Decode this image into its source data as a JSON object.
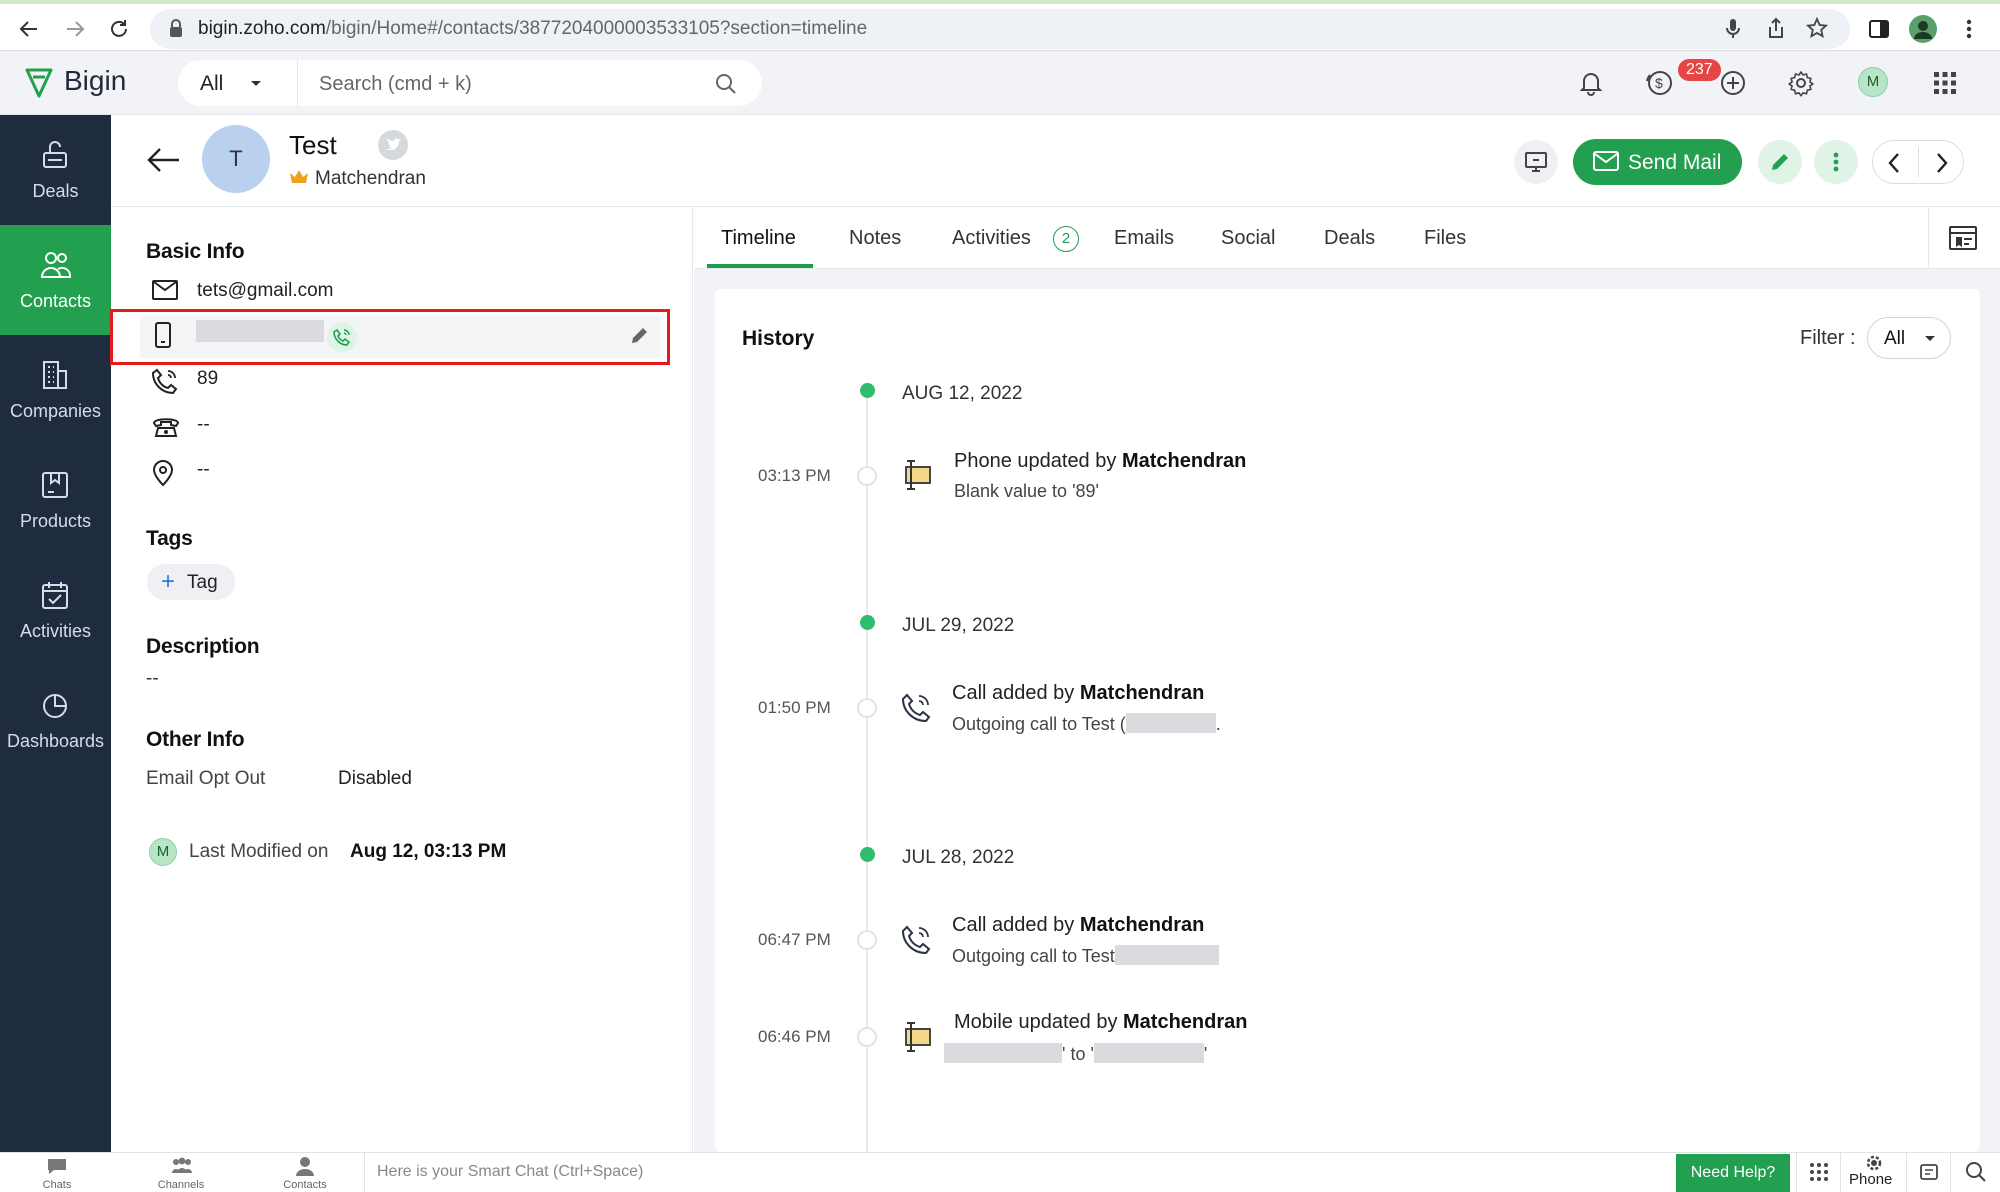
{
  "browser": {
    "url_host": "bigin.zoho.com",
    "url_path": "/bigin/Home#/contacts/3877204000003533105?section=timeline"
  },
  "header": {
    "app_name": "Bigin",
    "search_scope": "All",
    "search_placeholder": "Search (cmd + k)",
    "badge_count": "237",
    "user_initial": "M"
  },
  "sidebar": {
    "items": [
      {
        "label": "Deals",
        "icon": "deals-icon"
      },
      {
        "label": "Contacts",
        "icon": "contacts-icon",
        "active": true
      },
      {
        "label": "Companies",
        "icon": "companies-icon"
      },
      {
        "label": "Products",
        "icon": "products-icon"
      },
      {
        "label": "Activities",
        "icon": "activities-icon"
      },
      {
        "label": "Dashboards",
        "icon": "dashboards-icon"
      }
    ]
  },
  "record": {
    "avatar_initial": "T",
    "name": "Test",
    "owner": "Matchendran",
    "send_mail_label": "Send Mail"
  },
  "basic_info": {
    "title": "Basic Info",
    "email": "tets@gmail.com",
    "phone": "89",
    "home_phone": "--",
    "address": "--"
  },
  "tags": {
    "title": "Tags",
    "add_label": "Tag"
  },
  "description": {
    "title": "Description",
    "value": "--"
  },
  "other_info": {
    "title": "Other Info",
    "email_opt_out_label": "Email Opt Out",
    "email_opt_out_value": "Disabled"
  },
  "last_modified": {
    "initial": "M",
    "label": "Last Modified on",
    "value": "Aug 12, 03:13 PM"
  },
  "tabs": [
    {
      "label": "Timeline",
      "active": true
    },
    {
      "label": "Notes"
    },
    {
      "label": "Activities",
      "count": "2"
    },
    {
      "label": "Emails"
    },
    {
      "label": "Social"
    },
    {
      "label": "Deals"
    },
    {
      "label": "Files"
    }
  ],
  "history": {
    "title": "History",
    "filter_label": "Filter :",
    "filter_value": "All",
    "groups": [
      {
        "date": "AUG 12, 2022",
        "events": [
          {
            "time": "03:13 PM",
            "action": "Phone updated by",
            "by": "Matchendran",
            "detail": "Blank value to '89'",
            "icon": "field-update-icon"
          }
        ]
      },
      {
        "date": "JUL 29, 2022",
        "events": [
          {
            "time": "01:50 PM",
            "action": "Call added by",
            "by": "Matchendran",
            "detail": "Outgoing call to Test (",
            "detail_end": ".",
            "icon": "call-icon"
          }
        ]
      },
      {
        "date": "JUL 28, 2022",
        "events": [
          {
            "time": "06:47 PM",
            "action": "Call added by",
            "by": "Matchendran",
            "detail": "Outgoing call to Test",
            "icon": "call-icon"
          },
          {
            "time": "06:46 PM",
            "action": "Mobile updated by",
            "by": "Matchendran",
            "detail_mid": "' to '",
            "detail_end": "'",
            "icon": "field-update-icon"
          }
        ]
      }
    ]
  },
  "bottom_bar": {
    "chats": "Chats",
    "channels": "Channels",
    "contacts": "Contacts",
    "smart_chat_placeholder": "Here is your Smart Chat (Ctrl+Space)",
    "need_help": "Need Help?",
    "phone": "Phone"
  },
  "colors": {
    "accent_green": "#22a04f",
    "sidebar_bg": "#1f2b3e",
    "highlight_red": "#e41b1b",
    "badge_red": "#e64545"
  }
}
